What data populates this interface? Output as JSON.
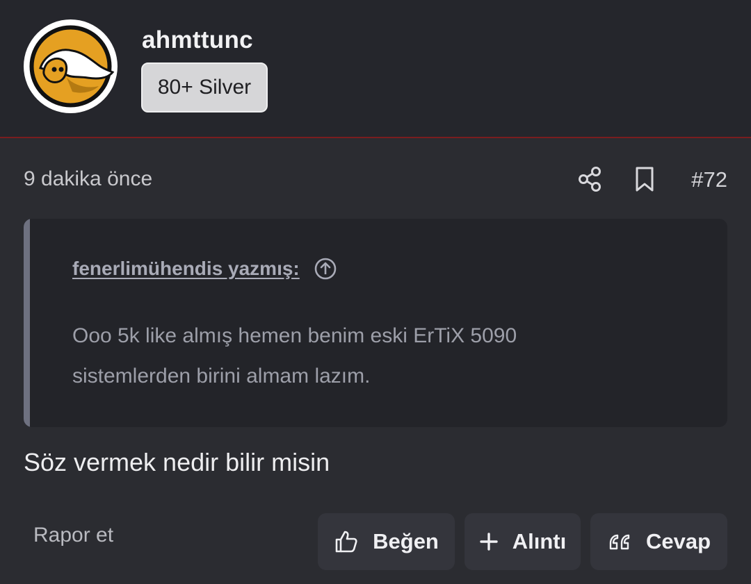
{
  "post": {
    "author": "ahmttunc",
    "badge": "80+ Silver",
    "time": "9 dakika önce",
    "number": "#72",
    "quote": {
      "author_line": "fenerlimühendis yazmış:",
      "text_line1": "Ooo 5k like almış hemen benim eski ErTiX 5090",
      "text_line2": "sistemlerden birini almam lazım."
    },
    "body": "Söz vermek nedir bilir misin"
  },
  "actions": {
    "report": "Rapor et",
    "like": "Beğen",
    "quote": "Alıntı",
    "reply": "Cevap"
  },
  "icons": {
    "share": "share-icon",
    "bookmark": "bookmark-icon",
    "jump": "arrow-up-circle-icon",
    "like": "thumbs-up-icon",
    "quote": "plus-icon",
    "reply": "quote-icon"
  },
  "colors": {
    "background": "#2b2c31",
    "header": "#25262c",
    "header_border": "#7a1d1f",
    "quote_background": "#232429",
    "button": "#34353c",
    "badge": "#d6d6d8"
  }
}
